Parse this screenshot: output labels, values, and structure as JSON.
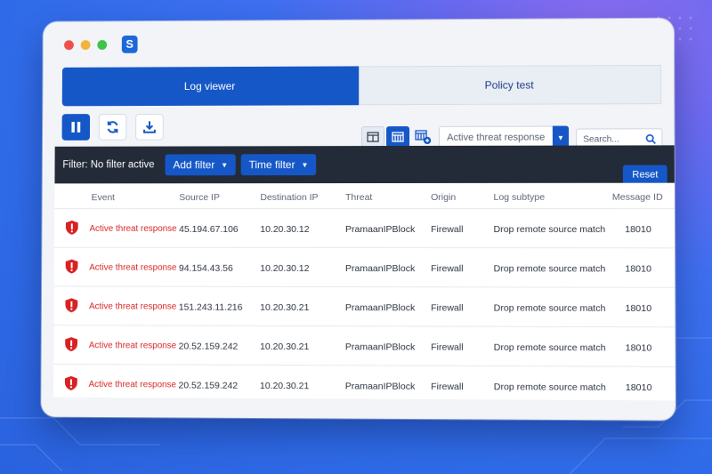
{
  "colors": {
    "accent": "#1557c7",
    "filter_bar": "#232b39",
    "event_red": "#d82626"
  },
  "app": {
    "logo_letter": "S"
  },
  "tabs": [
    {
      "label": "Log viewer"
    },
    {
      "label": "Policy test"
    }
  ],
  "toolbar": {
    "pause_icon": "pause-icon",
    "refresh_icon": "refresh-icon",
    "download_icon": "download-icon"
  },
  "log_type_select": {
    "value": "Active threat response"
  },
  "search": {
    "placeholder": "Search..."
  },
  "filter_bar": {
    "label": "Filter: No filter active",
    "add_filter": "Add filter",
    "time_filter": "Time filter",
    "reset": "Reset"
  },
  "table": {
    "headers": [
      "Event",
      "Source IP",
      "Destination IP",
      "Threat",
      "Origin",
      "Log subtype",
      "Message ID"
    ],
    "rows": [
      {
        "event": "Active threat response",
        "src": "45.194.67.106",
        "dst": "10.20.30.12",
        "threat": "PramaanIPBlock",
        "origin": "Firewall",
        "subtype": "Drop remote source match",
        "mid": "18010"
      },
      {
        "event": "Active threat response",
        "src": "94.154.43.56",
        "dst": "10.20.30.12",
        "threat": "PramaanIPBlock",
        "origin": "Firewall",
        "subtype": "Drop remote source match",
        "mid": "18010"
      },
      {
        "event": "Active threat response",
        "src": "151.243.11.216",
        "dst": "10.20.30.21",
        "threat": "PramaanIPBlock",
        "origin": "Firewall",
        "subtype": "Drop remote source match",
        "mid": "18010"
      },
      {
        "event": "Active threat response",
        "src": "20.52.159.242",
        "dst": "10.20.30.21",
        "threat": "PramaanIPBlock",
        "origin": "Firewall",
        "subtype": "Drop remote source match",
        "mid": "18010"
      },
      {
        "event": "Active threat response",
        "src": "20.52.159.242",
        "dst": "10.20.30.21",
        "threat": "PramaanIPBlock",
        "origin": "Firewall",
        "subtype": "Drop remote source match",
        "mid": "18010"
      }
    ]
  }
}
